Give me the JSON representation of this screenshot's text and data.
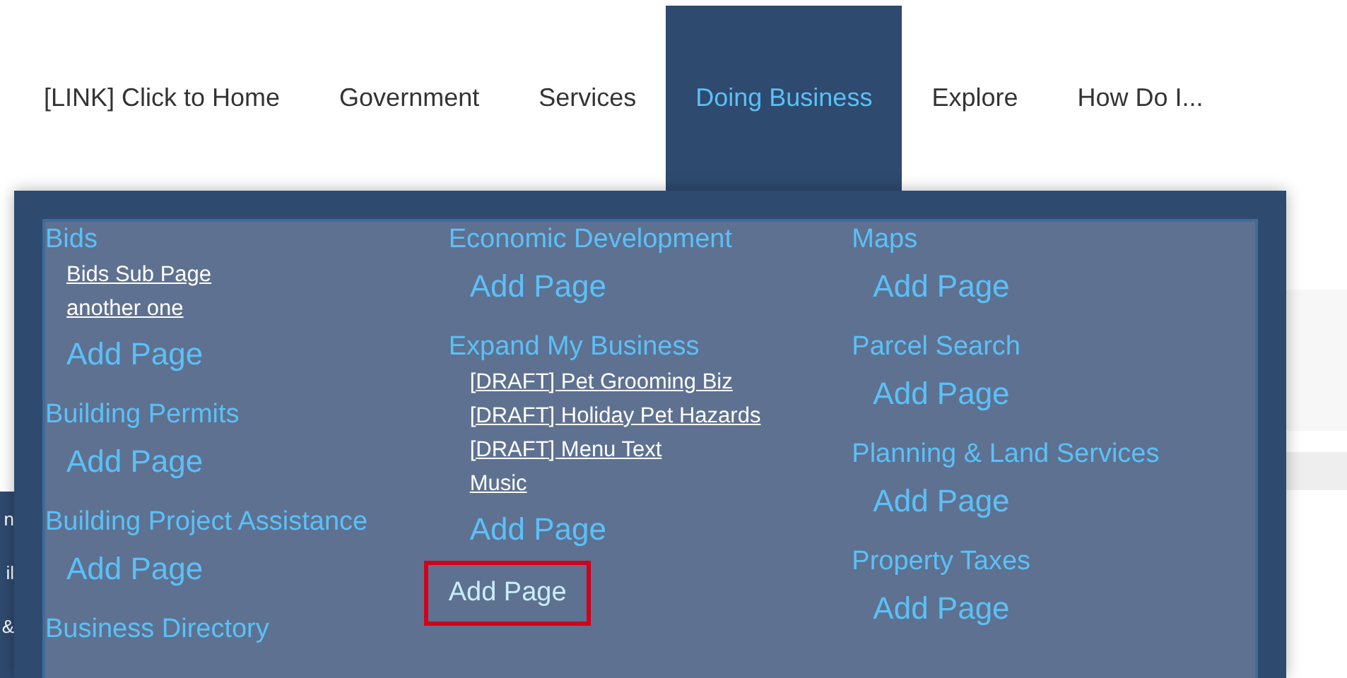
{
  "nav": [
    {
      "label": "[LINK] Click to Home",
      "selected": false
    },
    {
      "label": "Government",
      "selected": false
    },
    {
      "label": "Services",
      "selected": false
    },
    {
      "label": "Doing Business",
      "selected": true
    },
    {
      "label": "Explore",
      "selected": false
    },
    {
      "label": "How Do I...",
      "selected": false
    }
  ],
  "side_fragments": [
    "n",
    "il",
    "&"
  ],
  "mega_menu": {
    "columns": [
      {
        "items": [
          {
            "kind": "section",
            "title": "Bids",
            "subpages": [
              "Bids Sub Page",
              "another one"
            ],
            "add_label": "Add Page"
          },
          {
            "kind": "section",
            "title": "Building Permits",
            "add_label": "Add Page"
          },
          {
            "kind": "section",
            "title": "Building Project Assistance",
            "add_label": "Add Page"
          },
          {
            "kind": "section",
            "title": "Business Directory"
          }
        ]
      },
      {
        "items": [
          {
            "kind": "section",
            "title": "Economic Development",
            "add_label": "Add Page"
          },
          {
            "kind": "section",
            "title": "Expand My Business",
            "subpages": [
              "[DRAFT] Pet Grooming Biz",
              "[DRAFT] Holiday Pet Hazards",
              "[DRAFT] Menu Text",
              "Music"
            ],
            "add_label": "Add Page"
          },
          {
            "kind": "add",
            "label": "Add Page",
            "highlighted": true
          }
        ]
      },
      {
        "items": [
          {
            "kind": "section",
            "title": "Maps",
            "add_label": "Add Page"
          },
          {
            "kind": "section",
            "title": "Parcel Search",
            "add_label": "Add Page"
          },
          {
            "kind": "section",
            "title": "Planning & Land Services",
            "add_label": "Add Page"
          },
          {
            "kind": "section",
            "title": "Property Taxes",
            "add_label": "Add Page"
          }
        ]
      }
    ]
  }
}
